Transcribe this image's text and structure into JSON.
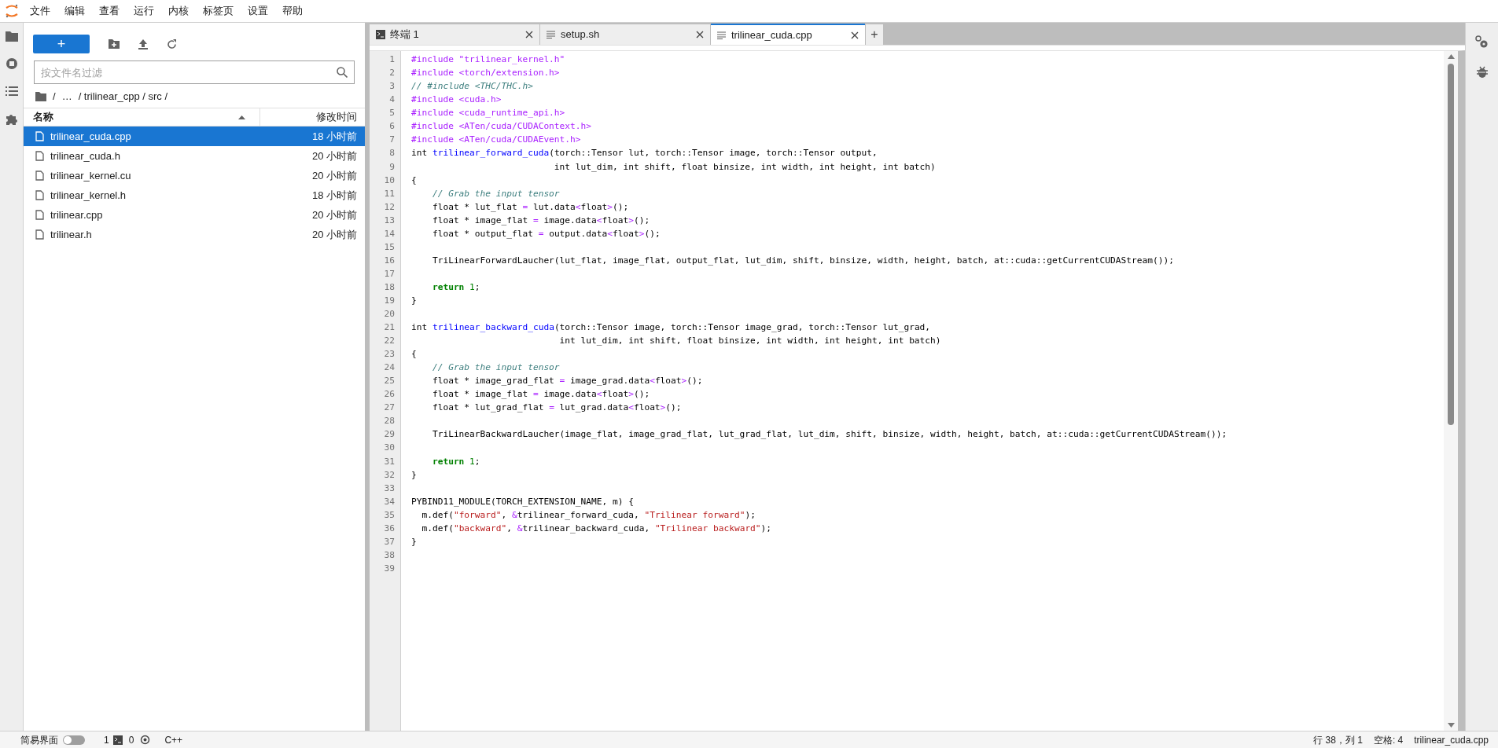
{
  "menu_bar": {
    "items": [
      "文件",
      "编辑",
      "查看",
      "运行",
      "内核",
      "标签页",
      "设置",
      "帮助"
    ]
  },
  "file_browser": {
    "new_button": "+",
    "filter": {
      "placeholder": "按文件名过滤"
    },
    "breadcrumb": [
      "/",
      "…",
      "/ trilinear_cpp / src /"
    ],
    "columns": [
      {
        "label": "名称",
        "sorted": true
      },
      {
        "label": "修改时间",
        "sorted": false
      }
    ],
    "files": [
      {
        "name": "trilinear_cuda.cpp",
        "modified": "18 小时前",
        "selected": true
      },
      {
        "name": "trilinear_cuda.h",
        "modified": "20 小时前",
        "selected": false
      },
      {
        "name": "trilinear_kernel.cu",
        "modified": "20 小时前",
        "selected": false
      },
      {
        "name": "trilinear_kernel.h",
        "modified": "18 小时前",
        "selected": false
      },
      {
        "name": "trilinear.cpp",
        "modified": "20 小时前",
        "selected": false
      },
      {
        "name": "trilinear.h",
        "modified": "20 小时前",
        "selected": false
      }
    ]
  },
  "tabs": [
    {
      "kind": "terminal",
      "label": "终端 1",
      "selected": false
    },
    {
      "kind": "file",
      "label": "setup.sh",
      "selected": false
    },
    {
      "kind": "file",
      "label": "trilinear_cuda.cpp",
      "selected": true
    }
  ],
  "new_tab_button": "+",
  "code_lines": [
    {
      "number": "1",
      "segments": [
        {
          "kind": "include",
          "text": "#include \"trilinear_kernel.h\""
        }
      ]
    },
    {
      "number": "2",
      "segments": [
        {
          "kind": "include",
          "text": "#include <torch/extension.h>"
        }
      ]
    },
    {
      "number": "3",
      "segments": [
        {
          "kind": "comment",
          "text": "// #include <THC/THC.h>"
        }
      ]
    },
    {
      "number": "4",
      "segments": [
        {
          "kind": "include",
          "text": "#include <cuda.h>"
        }
      ]
    },
    {
      "number": "5",
      "segments": [
        {
          "kind": "include",
          "text": "#include <cuda_runtime_api.h>"
        }
      ]
    },
    {
      "number": "6",
      "segments": [
        {
          "kind": "include",
          "text": "#include <ATen/cuda/CUDAContext.h>"
        }
      ]
    },
    {
      "number": "7",
      "segments": [
        {
          "kind": "include",
          "text": "#include <ATen/cuda/CUDAEvent.h>"
        }
      ]
    },
    {
      "number": "8",
      "segments": [
        {
          "kind": "plain",
          "text": "int "
        },
        {
          "kind": "function",
          "text": "trilinear_forward_cuda"
        },
        {
          "kind": "plain",
          "text": "(torch::Tensor lut, torch::Tensor image, torch::Tensor output,"
        }
      ]
    },
    {
      "number": "9",
      "segments": [
        {
          "kind": "plain",
          "text": "                           int lut_dim, int shift, float binsize, int width, int height, int batch)"
        }
      ]
    },
    {
      "number": "10",
      "segments": [
        {
          "kind": "plain",
          "text": "{"
        }
      ]
    },
    {
      "number": "11",
      "segments": [
        {
          "kind": "comment",
          "text": "    // Grab the input tensor"
        }
      ]
    },
    {
      "number": "12",
      "segments": [
        {
          "kind": "plain",
          "text": "    float * lut_flat "
        },
        {
          "kind": "operator",
          "text": "="
        },
        {
          "kind": "plain",
          "text": " lut.data"
        },
        {
          "kind": "operator",
          "text": "<"
        },
        {
          "kind": "plain",
          "text": "float"
        },
        {
          "kind": "operator",
          "text": ">"
        },
        {
          "kind": "plain",
          "text": "();"
        }
      ]
    },
    {
      "number": "13",
      "segments": [
        {
          "kind": "plain",
          "text": "    float * image_flat "
        },
        {
          "kind": "operator",
          "text": "="
        },
        {
          "kind": "plain",
          "text": " image.data"
        },
        {
          "kind": "operator",
          "text": "<"
        },
        {
          "kind": "plain",
          "text": "float"
        },
        {
          "kind": "operator",
          "text": ">"
        },
        {
          "kind": "plain",
          "text": "();"
        }
      ]
    },
    {
      "number": "14",
      "segments": [
        {
          "kind": "plain",
          "text": "    float * output_flat "
        },
        {
          "kind": "operator",
          "text": "="
        },
        {
          "kind": "plain",
          "text": " output.data"
        },
        {
          "kind": "operator",
          "text": "<"
        },
        {
          "kind": "plain",
          "text": "float"
        },
        {
          "kind": "operator",
          "text": ">"
        },
        {
          "kind": "plain",
          "text": "();"
        }
      ]
    },
    {
      "number": "15"
    },
    {
      "number": "16",
      "segments": [
        {
          "kind": "plain",
          "text": "    TriLinearForwardLaucher(lut_flat, image_flat, output_flat, lut_dim, shift, binsize, width, height, batch, at::cuda::getCurrentCUDAStream());"
        }
      ]
    },
    {
      "number": "17"
    },
    {
      "number": "18",
      "segments": [
        {
          "kind": "keyword",
          "text": "    return"
        },
        {
          "kind": "number",
          "text": " 1"
        },
        {
          "kind": "plain",
          "text": ";"
        }
      ]
    },
    {
      "number": "19",
      "segments": [
        {
          "kind": "plain",
          "text": "}"
        }
      ]
    },
    {
      "number": "20"
    },
    {
      "number": "21",
      "segments": [
        {
          "kind": "plain",
          "text": "int "
        },
        {
          "kind": "function",
          "text": "trilinear_backward_cuda"
        },
        {
          "kind": "plain",
          "text": "(torch::Tensor image, torch::Tensor image_grad, torch::Tensor lut_grad,"
        }
      ]
    },
    {
      "number": "22",
      "segments": [
        {
          "kind": "plain",
          "text": "                            int lut_dim, int shift, float binsize, int width, int height, int batch)"
        }
      ]
    },
    {
      "number": "23",
      "segments": [
        {
          "kind": "plain",
          "text": "{"
        }
      ]
    },
    {
      "number": "24",
      "segments": [
        {
          "kind": "comment",
          "text": "    // Grab the input tensor"
        }
      ]
    },
    {
      "number": "25",
      "segments": [
        {
          "kind": "plain",
          "text": "    float * image_grad_flat "
        },
        {
          "kind": "operator",
          "text": "="
        },
        {
          "kind": "plain",
          "text": " image_grad.data"
        },
        {
          "kind": "operator",
          "text": "<"
        },
        {
          "kind": "plain",
          "text": "float"
        },
        {
          "kind": "operator",
          "text": ">"
        },
        {
          "kind": "plain",
          "text": "();"
        }
      ]
    },
    {
      "number": "26",
      "segments": [
        {
          "kind": "plain",
          "text": "    float * image_flat "
        },
        {
          "kind": "operator",
          "text": "="
        },
        {
          "kind": "plain",
          "text": " image.data"
        },
        {
          "kind": "operator",
          "text": "<"
        },
        {
          "kind": "plain",
          "text": "float"
        },
        {
          "kind": "operator",
          "text": ">"
        },
        {
          "kind": "plain",
          "text": "();"
        }
      ]
    },
    {
      "number": "27",
      "segments": [
        {
          "kind": "plain",
          "text": "    float * lut_grad_flat "
        },
        {
          "kind": "operator",
          "text": "="
        },
        {
          "kind": "plain",
          "text": " lut_grad.data"
        },
        {
          "kind": "operator",
          "text": "<"
        },
        {
          "kind": "plain",
          "text": "float"
        },
        {
          "kind": "operator",
          "text": ">"
        },
        {
          "kind": "plain",
          "text": "();"
        }
      ]
    },
    {
      "number": "28"
    },
    {
      "number": "29",
      "segments": [
        {
          "kind": "plain",
          "text": "    TriLinearBackwardLaucher(image_flat, image_grad_flat, lut_grad_flat, lut_dim, shift, binsize, width, height, batch, at::cuda::getCurrentCUDAStream());"
        }
      ]
    },
    {
      "number": "30"
    },
    {
      "number": "31",
      "segments": [
        {
          "kind": "keyword",
          "text": "    return"
        },
        {
          "kind": "number",
          "text": " 1"
        },
        {
          "kind": "plain",
          "text": ";"
        }
      ]
    },
    {
      "number": "32",
      "segments": [
        {
          "kind": "plain",
          "text": "}"
        }
      ]
    },
    {
      "number": "33"
    },
    {
      "number": "34",
      "segments": [
        {
          "kind": "plain",
          "text": "PYBIND11_MODULE(TORCH_EXTENSION_NAME, m) {"
        }
      ]
    },
    {
      "number": "35",
      "segments": [
        {
          "kind": "plain",
          "text": "  m.def("
        },
        {
          "kind": "string",
          "text": "\"forward\""
        },
        {
          "kind": "plain",
          "text": ", "
        },
        {
          "kind": "operator",
          "text": "&"
        },
        {
          "kind": "plain",
          "text": "trilinear_forward_cuda, "
        },
        {
          "kind": "string",
          "text": "\"Trilinear forward\""
        },
        {
          "kind": "plain",
          "text": ");"
        }
      ]
    },
    {
      "number": "36",
      "segments": [
        {
          "kind": "plain",
          "text": "  m.def("
        },
        {
          "kind": "string",
          "text": "\"backward\""
        },
        {
          "kind": "plain",
          "text": ", "
        },
        {
          "kind": "operator",
          "text": "&"
        },
        {
          "kind": "plain",
          "text": "trilinear_backward_cuda, "
        },
        {
          "kind": "string",
          "text": "\"Trilinear backward\""
        },
        {
          "kind": "plain",
          "text": ");"
        }
      ]
    },
    {
      "number": "37",
      "segments": [
        {
          "kind": "plain",
          "text": "}"
        }
      ]
    },
    {
      "number": "38"
    },
    {
      "number": "39"
    }
  ],
  "status_bar": {
    "simple_mode": {
      "label": "简易界面",
      "on": false
    },
    "terminals": "1",
    "kernels": "0",
    "language": "C++",
    "cursor": "行 38，列 1",
    "indent": "空格: 4",
    "file": "trilinear_cuda.cpp"
  }
}
